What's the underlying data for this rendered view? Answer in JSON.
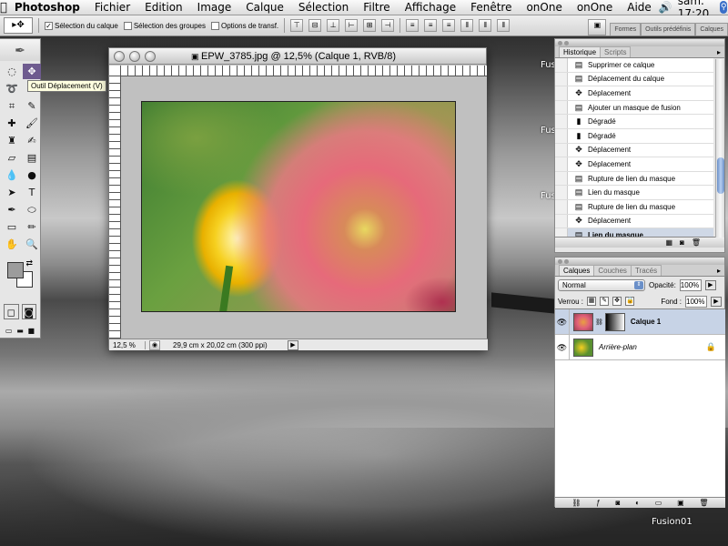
{
  "menubar": {
    "apple": "",
    "items": [
      "Photoshop",
      "Fichier",
      "Edition",
      "Image",
      "Calque",
      "Sélection",
      "Filtre",
      "Affichage",
      "Fenêtre",
      "onOne",
      "onOne",
      "Aide"
    ],
    "volume_icon": "speaker-icon",
    "clock": "sam. 17:20"
  },
  "options": {
    "tool_preset": "▸✥",
    "auto_select_layer": "Sélection du calque",
    "auto_select_groups": "Sélection des groupes",
    "transform_options": "Options de transf."
  },
  "wells": [
    "Formes",
    "Outils prédéfinis",
    "Calques"
  ],
  "tooltip": "Outil Déplacement (V)",
  "document": {
    "title": "EPW_3785.jpg @ 12,5% (Calque 1, RVB/8)",
    "zoom": "12,5 %",
    "info": "29,9 cm x 20,02 cm (300 ppi)"
  },
  "desktop_icons": [
    "Fusi",
    "Fus",
    "Fus",
    "Fusion01"
  ],
  "history": {
    "tabs": [
      "Historique",
      "Scripts"
    ],
    "items": [
      {
        "label": "Supprimer ce calque",
        "icon": "▤"
      },
      {
        "label": "Déplacement du calque",
        "icon": "▤"
      },
      {
        "label": "Déplacement",
        "icon": "✥"
      },
      {
        "label": "Ajouter un masque de fusion",
        "icon": "▤"
      },
      {
        "label": "Dégradé",
        "icon": "▮"
      },
      {
        "label": "Dégradé",
        "icon": "▮"
      },
      {
        "label": "Déplacement",
        "icon": "✥"
      },
      {
        "label": "Déplacement",
        "icon": "✥"
      },
      {
        "label": "Rupture de lien du masque",
        "icon": "▤"
      },
      {
        "label": "Lien du masque",
        "icon": "▤"
      },
      {
        "label": "Rupture de lien du masque",
        "icon": "▤"
      },
      {
        "label": "Déplacement",
        "icon": "✥"
      },
      {
        "label": "Lien du masque",
        "icon": "▤"
      }
    ]
  },
  "layers": {
    "tabs": [
      "Calques",
      "Couches",
      "Tracés"
    ],
    "blend_mode": "Normal",
    "opacity_label": "Opacité:",
    "opacity": "100%",
    "lock_label": "Verrou :",
    "fill_label": "Fond :",
    "fill": "100%",
    "items": [
      {
        "name": "Calque 1",
        "selected": true
      },
      {
        "name": "Arrière-plan",
        "selected": false
      }
    ]
  }
}
